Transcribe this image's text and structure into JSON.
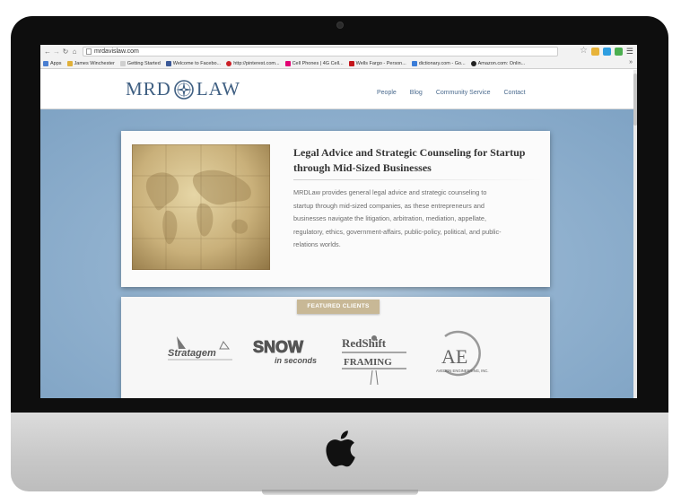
{
  "browser": {
    "url": "mrdavislaw.com",
    "bookmarks": [
      {
        "label": "Apps",
        "color": "#4a7fd1"
      },
      {
        "label": "James Winchester",
        "color": "#e0b03a"
      },
      {
        "label": "Getting Started",
        "color": "#cfcfcf"
      },
      {
        "label": "Welcome to Facebo...",
        "color": "#3b5998"
      },
      {
        "label": "http://pinterest.com...",
        "color": "#cb2027"
      },
      {
        "label": "Cell Phones | 4G Cell...",
        "color": "#e20074"
      },
      {
        "label": "Wells Fargo - Person...",
        "color": "#c4161c"
      },
      {
        "label": "dictionary.com - Go...",
        "color": "#3b7dd8"
      },
      {
        "label": "Amazon.com: Onlin...",
        "color": "#222222"
      }
    ],
    "more": "»"
  },
  "site": {
    "logo_left": "MRD",
    "logo_right": "LAW",
    "nav": [
      "People",
      "Blog",
      "Community Service",
      "Contact"
    ],
    "intro_title": "Legal Advice and Strategic Counseling for Startup through Mid-Sized Businesses",
    "intro_body": "MRDLaw provides general legal advice and strategic counseling to startup through mid-sized companies, as these entrepreneurs and businesses navigate the litigation, arbitration, mediation, appellate, regulatory, ethics, government-affairs, public-policy, political, and public-relations worlds.",
    "featured_label": "FEATURED CLIENTS",
    "clients": {
      "stratagem": "Stratagem",
      "snow_top": "SNOW",
      "snow_bottom": "in seconds",
      "redshift_top": "RedShift",
      "redshift_bottom": "FRAMING",
      "avedon_mark": "AE",
      "avedon_name": "AVEDON ENGINEERING, INC."
    }
  },
  "colors": {
    "page_bg": "#8fb0cf",
    "brand": "#3f5f82",
    "featured_tab": "#c8b896"
  }
}
